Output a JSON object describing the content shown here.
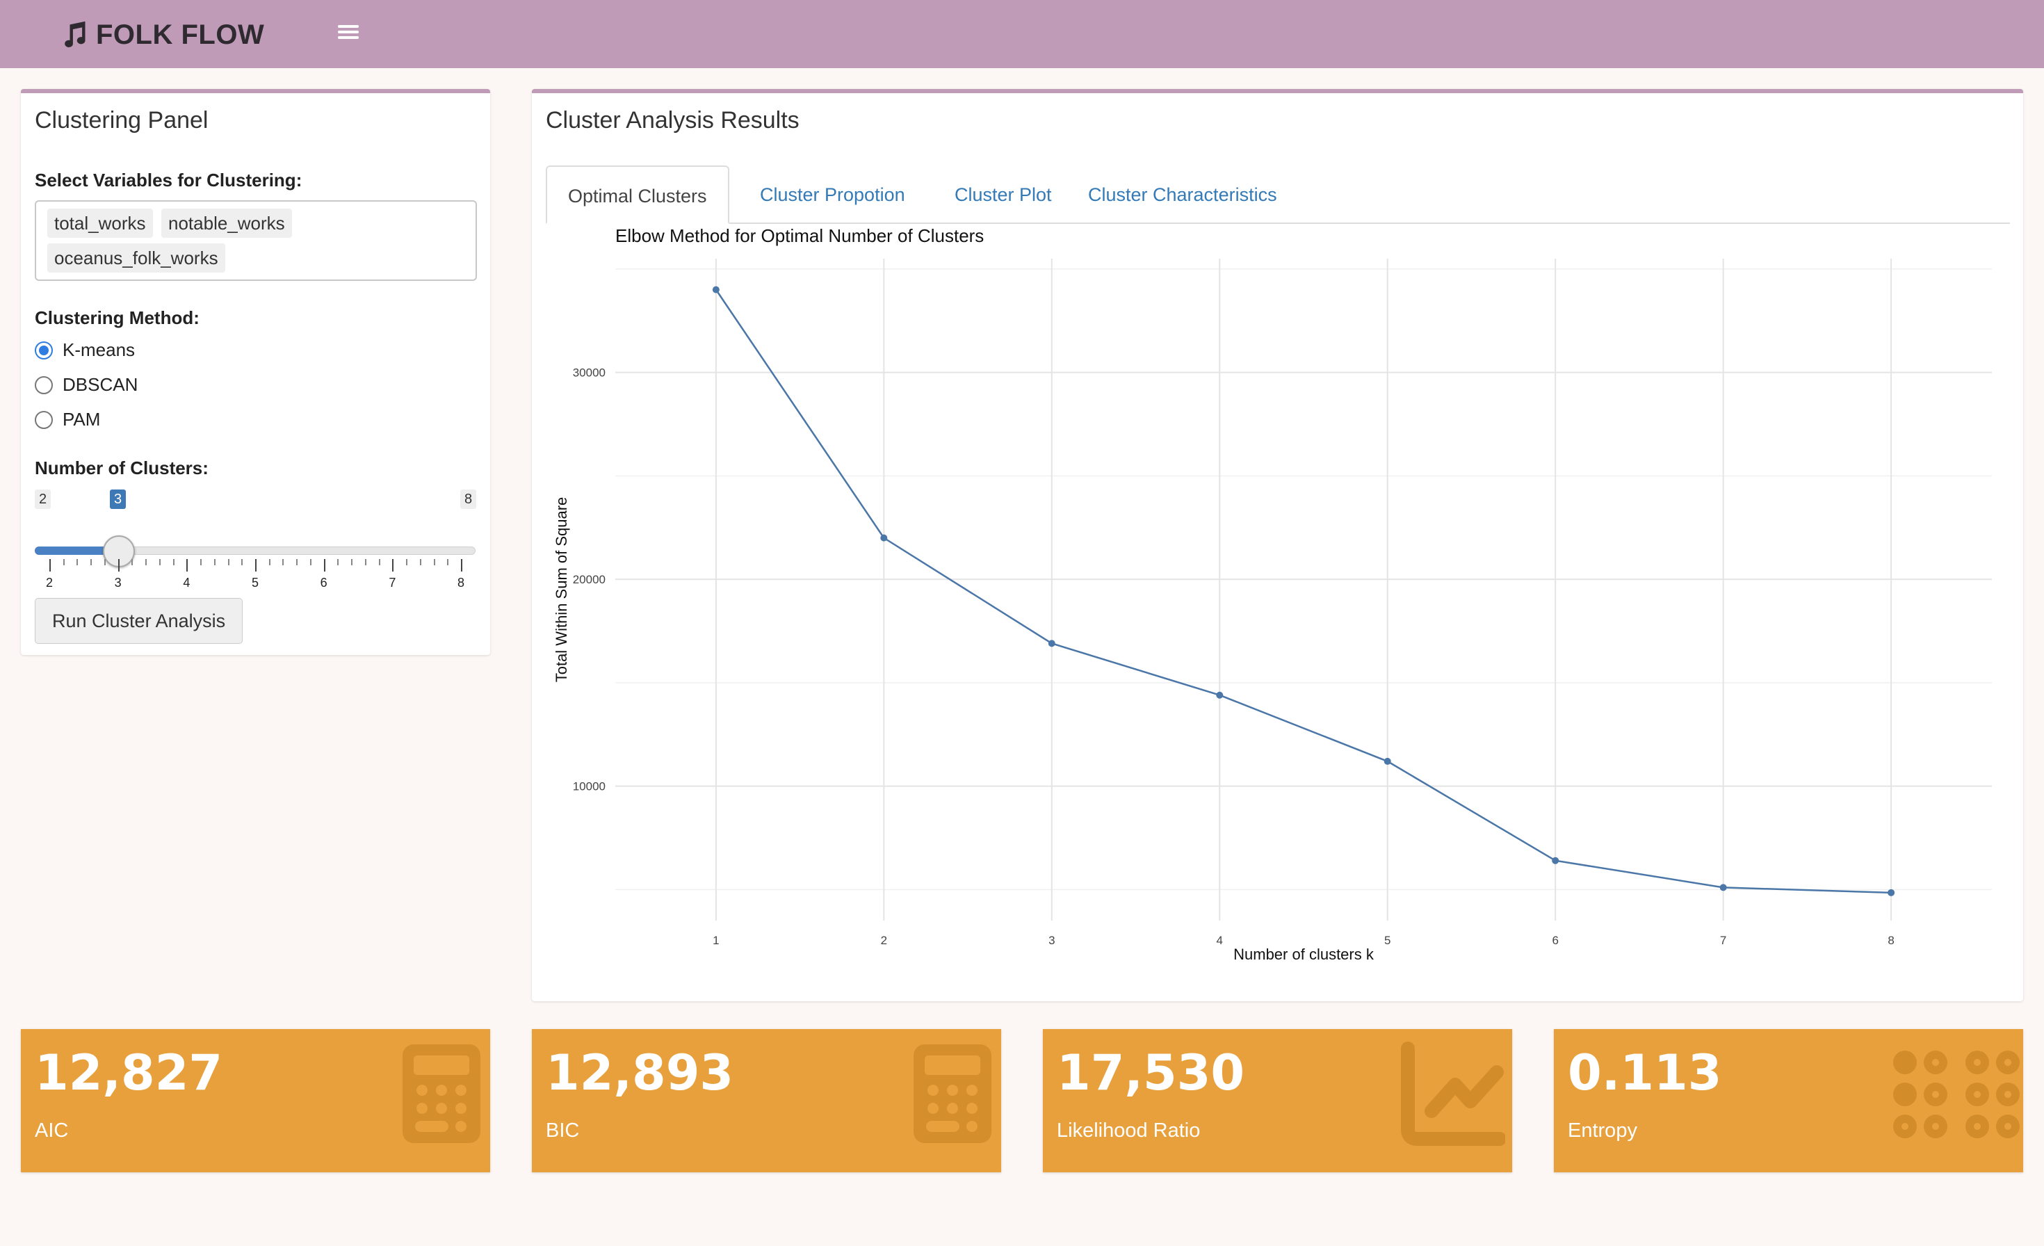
{
  "app": {
    "title": "FOLK FLOW",
    "icon": "music-note-icon"
  },
  "left_panel": {
    "title": "Clustering Panel",
    "variables_label": "Select Variables for Clustering:",
    "variables": [
      "total_works",
      "notable_works",
      "oceanus_folk_works"
    ],
    "method_label": "Clustering Method:",
    "methods": [
      {
        "label": "K-means",
        "checked": true
      },
      {
        "label": "DBSCAN",
        "checked": false
      },
      {
        "label": "PAM",
        "checked": false
      }
    ],
    "clusters_label": "Number of Clusters:",
    "slider": {
      "min": "2",
      "max": "8",
      "value": "3",
      "ticks": [
        "2",
        "3",
        "4",
        "5",
        "6",
        "7",
        "8"
      ]
    },
    "run_button": "Run Cluster Analysis"
  },
  "right_panel": {
    "title": "Cluster Analysis Results",
    "tabs": [
      "Optimal Clusters",
      "Cluster Propotion",
      "Cluster Plot",
      "Cluster Characteristics"
    ],
    "active_tab": 0
  },
  "chart_data": {
    "type": "line",
    "title": "Elbow Method for Optimal Number of Clusters",
    "xlabel": "Number of clusters k",
    "ylabel": "Total Within Sum of Square",
    "x": [
      1,
      2,
      3,
      4,
      5,
      6,
      7,
      8
    ],
    "series": [
      {
        "values": [
          34000,
          22000,
          16900,
          14400,
          11200,
          6400,
          5100,
          4850
        ]
      }
    ],
    "xlim": [
      0.4,
      8.6
    ],
    "ylim": [
      3500,
      35500
    ],
    "yticks": [
      10000,
      20000,
      30000
    ],
    "grid": true,
    "line_color": "#4a76a8"
  },
  "value_boxes": [
    {
      "value": "12,827",
      "label": "AIC",
      "icon": "calculator-icon"
    },
    {
      "value": "12,893",
      "label": "BIC",
      "icon": "calculator-icon"
    },
    {
      "value": "17,530",
      "label": "Likelihood Ratio",
      "icon": "chart-line-icon"
    },
    {
      "value": "0.113",
      "label": "Entropy",
      "icon": "dice-grid-icon"
    }
  ],
  "colors": {
    "navbar": "#bf9bb8",
    "value_box": "#e7a03c",
    "link": "#337ab7",
    "background": "#fcf6f4"
  }
}
